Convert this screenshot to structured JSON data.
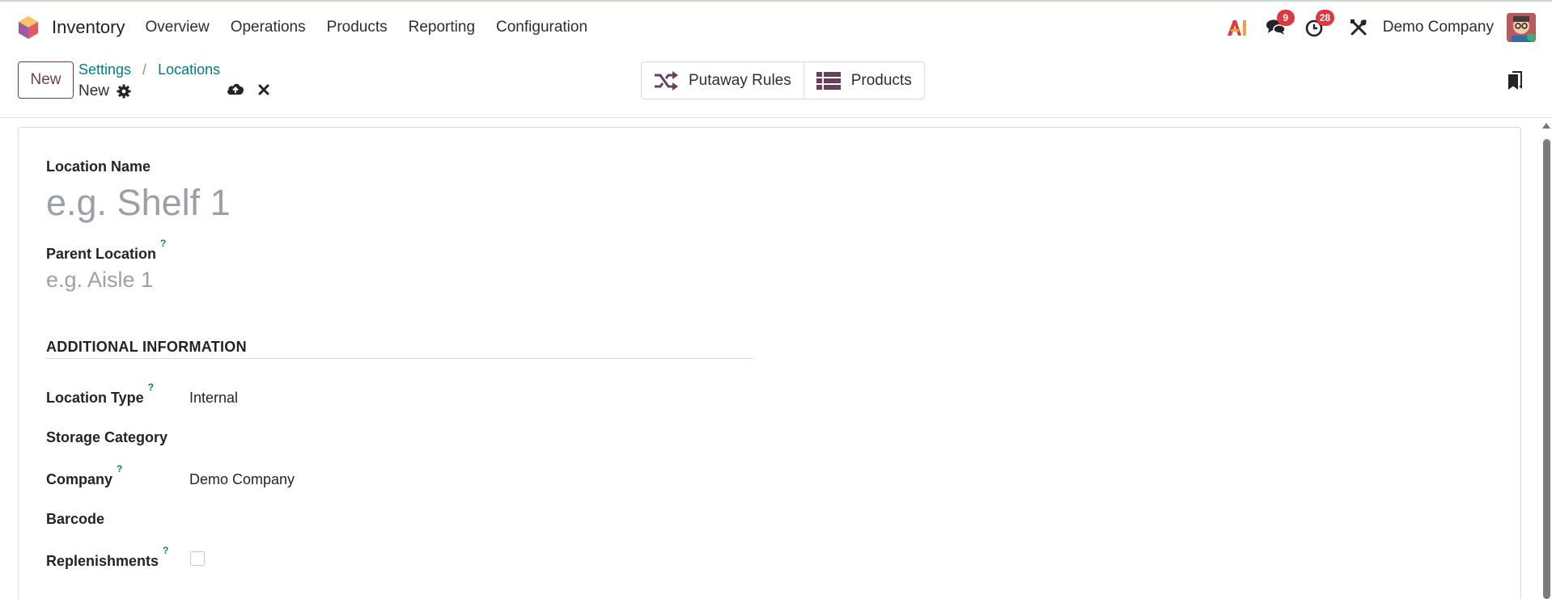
{
  "navbar": {
    "app_name": "Inventory",
    "menu": [
      "Overview",
      "Operations",
      "Products",
      "Reporting",
      "Configuration"
    ],
    "messages_badge": "9",
    "activities_badge": "28",
    "company": "Demo Company"
  },
  "control_panel": {
    "new_label": "New",
    "breadcrumb": [
      "Settings",
      "Locations"
    ],
    "breadcrumb_separator": "/",
    "record_name": "New",
    "smart_buttons": {
      "putaway_label": "Putaway Rules",
      "products_label": "Products"
    }
  },
  "form": {
    "location_name": {
      "label": "Location Name",
      "value": "",
      "placeholder": "e.g. Shelf 1"
    },
    "parent_location": {
      "label": "Parent Location",
      "tooltip": "?",
      "value": "",
      "placeholder": "e.g. Aisle 1"
    },
    "section_title": "ADDITIONAL INFORMATION",
    "location_type": {
      "label": "Location Type",
      "tooltip": "?",
      "value": "Internal"
    },
    "storage_category": {
      "label": "Storage Category",
      "value": ""
    },
    "company": {
      "label": "Company",
      "tooltip": "?",
      "value": "Demo Company"
    },
    "barcode": {
      "label": "Barcode",
      "value": ""
    },
    "replenishments": {
      "label": "Replenishments",
      "tooltip": "?",
      "checked": false
    }
  },
  "colors": {
    "brand": "#6b3f5a",
    "link": "#017e84",
    "badge": "#e0383e"
  },
  "icons": {
    "app_logo": "inventory-cube-icon",
    "ai": "ai-icon",
    "messages": "chat-bubbles-icon",
    "activities": "clock-icon",
    "debug": "tools-icon",
    "gear": "gear-icon",
    "save": "cloud-upload-icon",
    "discard": "close-icon",
    "putaway": "shuffle-icon",
    "products": "list-icon",
    "bookmark": "bookmark-icon"
  }
}
